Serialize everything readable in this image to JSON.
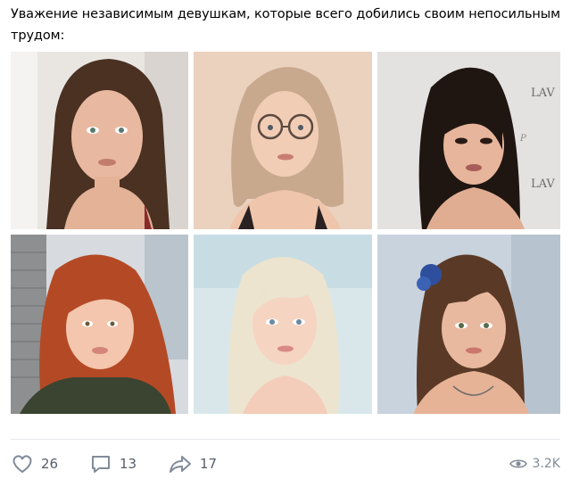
{
  "post": {
    "text": "Уважение независимым девушкам, которые всего добились своим непосильным трудом:"
  },
  "photos": [
    {
      "name": "photo-1"
    },
    {
      "name": "photo-2"
    },
    {
      "name": "photo-3"
    },
    {
      "name": "photo-4"
    },
    {
      "name": "photo-5"
    },
    {
      "name": "photo-6"
    }
  ],
  "actions": {
    "likes": "26",
    "comments": "13",
    "shares": "17",
    "views": "3.2K"
  },
  "icons": {
    "like": "heart-icon",
    "comment": "comment-icon",
    "share": "share-arrow-icon",
    "views": "eye-icon"
  },
  "colors": {
    "icon": "#818c99",
    "count": "#555e6a",
    "divider": "#e7e8ec"
  }
}
